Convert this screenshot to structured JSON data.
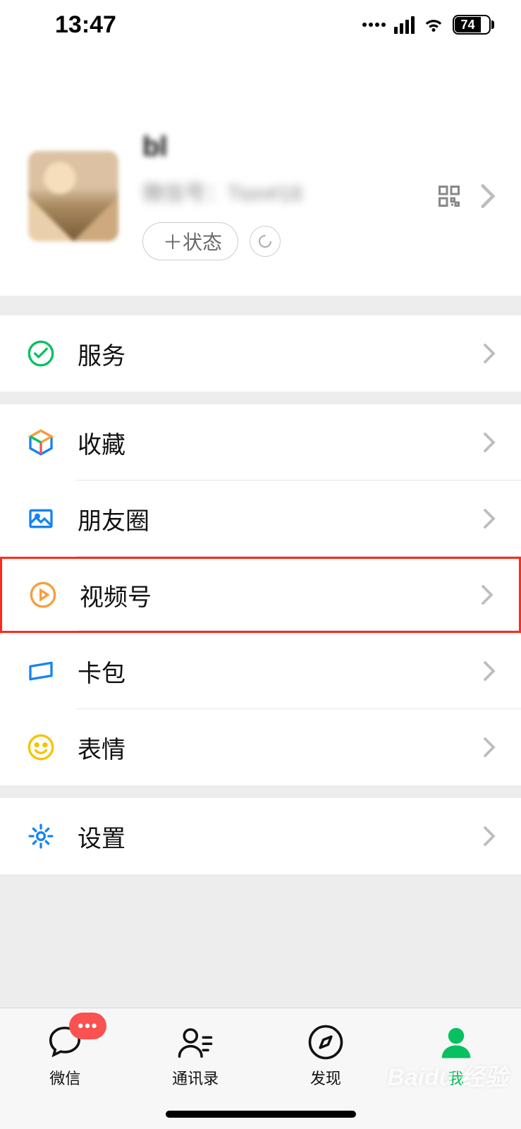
{
  "status": {
    "time": "13:47",
    "battery": "74"
  },
  "profile": {
    "nickname": "bl",
    "wxid_line": "微信号：Tion#16",
    "status_button": "＋状态"
  },
  "menu": {
    "services": "服务",
    "favorites": "收藏",
    "moments": "朋友圈",
    "channels": "视频号",
    "cards": "卡包",
    "stickers": "表情",
    "settings": "设置"
  },
  "tabs": {
    "chat": "微信",
    "contacts": "通讯录",
    "discover": "发现",
    "me": "我",
    "badge": "•••"
  },
  "watermark": "Baidu 经验"
}
